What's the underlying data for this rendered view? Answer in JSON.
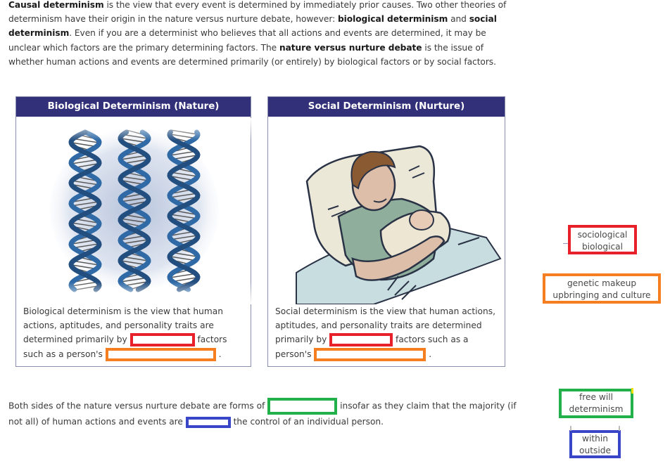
{
  "intro": {
    "s1_bold": "Causal determinism",
    "s1_rest": " is the view that every event is determined by immediately prior causes. Two other theories of determinism have their origin in the nature versus nurture debate, however: ",
    "bio_bold": "biological determinism",
    "and": " and ",
    "social_bold": "social determinism",
    "s2": ". Even if you are a determinist who believes that all actions and events are determined, it may be unclear which factors are the primary determining factors. The ",
    "nvn_bold": "nature versus nurture debate",
    "s3": " is the issue of whether human actions and events are determined primarily (or entirely) by biological factors or by social factors."
  },
  "panels": {
    "left": {
      "title": "Biological Determinism (Nature)",
      "image": "dna-helix-illustration",
      "text_1": "Biological determinism is the view that human actions, aptitudes, and personality traits are determined primarily by ",
      "text_2": " factors such as a person's ",
      "text_3": " ."
    },
    "right": {
      "title": "Social Determinism (Nurture)",
      "image": "mother-holding-newborn-illustration",
      "text_1": "Social determinism is the view that human actions, aptitudes, and personality traits are determined primarily by ",
      "text_2": " factors such as a person's ",
      "text_3": " ."
    }
  },
  "bottom": {
    "text_1": "Both sides of the nature versus nurture debate are forms of ",
    "text_2": " insofar as they claim that the majority (if not all) of human actions and events are ",
    "text_3": " the control of an individual person."
  },
  "choices": {
    "red": [
      "sociological",
      "biological"
    ],
    "orange": [
      "genetic makeup",
      "upbringing and culture"
    ],
    "green": [
      "free will",
      "determinism"
    ],
    "blue": [
      "within",
      "outside"
    ]
  },
  "colors": {
    "header": "#33307a",
    "red": "#e8202a",
    "orange": "#f57f20",
    "green": "#22b04a",
    "blue": "#3a46c8"
  }
}
